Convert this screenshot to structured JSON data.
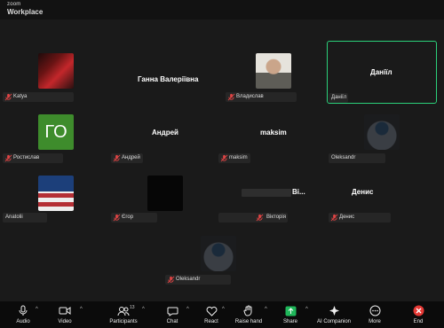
{
  "app": {
    "brand_top": "zoom",
    "brand_bottom": "Workplace"
  },
  "participants": [
    {
      "name": "Katya",
      "muted": true
    },
    {
      "name": "Ганна Валеріївна",
      "muted": false
    },
    {
      "name": "Владислав",
      "muted": true
    },
    {
      "name": "Даніїл",
      "muted": false,
      "active_speaker": true
    },
    {
      "name": "Ростислав",
      "muted": true,
      "initials": "ГО"
    },
    {
      "name": "Андрей",
      "muted": true
    },
    {
      "name": "maksim",
      "muted": true
    },
    {
      "name": "Oleksandr",
      "muted": false
    },
    {
      "name": "Anatolii",
      "muted": false
    },
    {
      "name": "Єгор",
      "muted": true
    },
    {
      "name": "Вікторія",
      "muted": true,
      "center_label": "Ві..."
    },
    {
      "name": "Денис",
      "muted": true
    },
    {
      "name": "Oleksandr",
      "muted": true
    }
  ],
  "toolbar": {
    "audio": "Audio",
    "video": "Video",
    "participants": "Participants",
    "participants_count": "13",
    "chat": "Chat",
    "react": "React",
    "raise_hand": "Raise hand",
    "share": "Share",
    "ai_companion": "AI Companion",
    "more": "More",
    "end": "End"
  },
  "colors": {
    "active_border": "#2bd07a",
    "muted": "#e04444",
    "share": "#1fb75a",
    "end": "#e53935"
  }
}
